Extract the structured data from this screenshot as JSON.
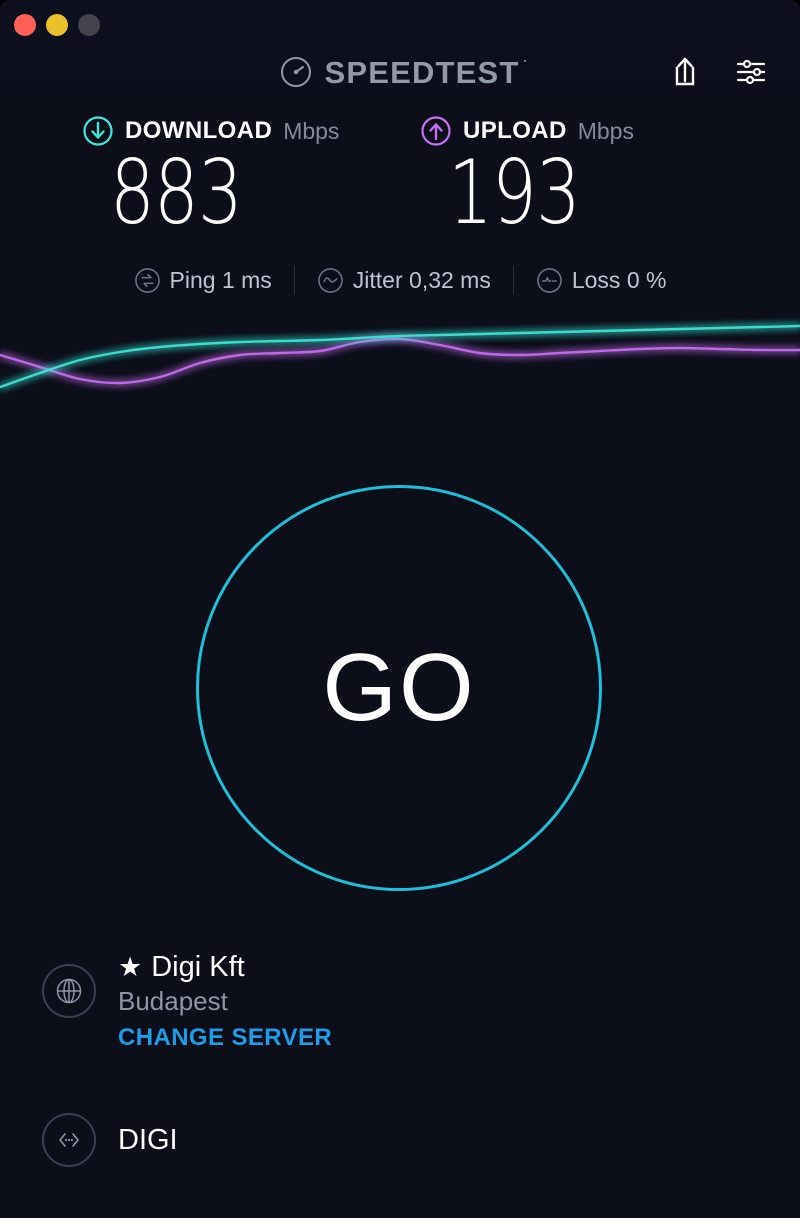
{
  "window": {
    "traffic_lights": [
      {
        "name": "close",
        "color": "#ff5f56"
      },
      {
        "name": "minimize",
        "color": "#e8c22c"
      },
      {
        "name": "zoom",
        "color": "#43434d"
      }
    ]
  },
  "header": {
    "brand": "SPEEDTEST",
    "trademark": "·",
    "logo_icon": "speedometer-icon",
    "share_icon": "share-icon",
    "settings_icon": "settings-sliders-icon"
  },
  "results": {
    "download": {
      "label": "DOWNLOAD",
      "unit": "Mbps",
      "value": "883",
      "icon": "arrow-down-circle-icon",
      "color": "#3ee8d8"
    },
    "upload": {
      "label": "UPLOAD",
      "unit": "Mbps",
      "value": "193",
      "icon": "arrow-up-circle-icon",
      "color": "#c86ef0"
    }
  },
  "stats": [
    {
      "icon": "ping-icon",
      "text": "Ping 1 ms"
    },
    {
      "icon": "jitter-icon",
      "text": "Jitter 0,32 ms"
    },
    {
      "icon": "loss-icon",
      "text": "Loss 0 %"
    }
  ],
  "go_button": {
    "label": "GO",
    "ring_color": "#1fbfd8"
  },
  "server": {
    "icon": "globe-icon",
    "favorite_icon": "star-icon",
    "name": "Digi Kft",
    "city": "Budapest",
    "change_label": "CHANGE SERVER",
    "change_color": "#1f9ce8"
  },
  "isp": {
    "icon": "connection-icon",
    "name": "DIGI"
  },
  "chart_data": {
    "type": "line",
    "title": "",
    "xlabel": "",
    "ylabel": "",
    "grid": false,
    "legend": "none",
    "x": [
      0,
      40,
      80,
      120,
      160,
      200,
      240,
      280,
      320,
      360,
      400,
      440,
      480,
      520,
      560,
      600,
      640,
      680,
      720,
      760,
      800
    ],
    "series": [
      {
        "name": "download",
        "color": "#3ee8d8",
        "values": [
          82,
          68,
          55,
          47,
          42,
          39,
          37,
          36,
          35,
          33,
          31,
          30,
          29,
          28,
          27,
          26,
          25,
          24,
          23,
          22,
          21
        ]
      },
      {
        "name": "upload",
        "color": "#c86ef0",
        "values": [
          50,
          62,
          74,
          78,
          72,
          58,
          50,
          48,
          46,
          37,
          34,
          40,
          48,
          50,
          48,
          46,
          44,
          43,
          44,
          45,
          45
        ]
      }
    ],
    "ylim": [
      0,
      100
    ],
    "xlim": [
      0,
      800
    ]
  }
}
